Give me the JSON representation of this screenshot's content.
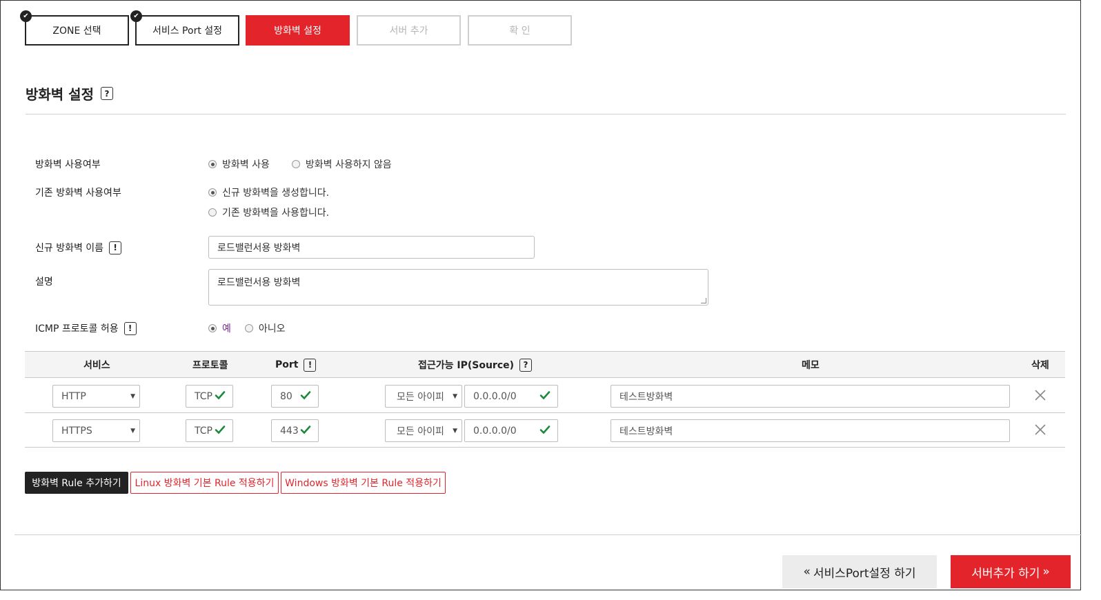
{
  "steps": [
    {
      "label": "ZONE 선택",
      "state": "done"
    },
    {
      "label": "서비스 Port 설정",
      "state": "done"
    },
    {
      "label": "방화벽 설정",
      "state": "active"
    },
    {
      "label": "서버 추가",
      "state": "todo"
    },
    {
      "label": "확 인",
      "state": "todo"
    }
  ],
  "section": {
    "title": "방화벽 설정",
    "help": "?"
  },
  "form": {
    "use_firewall": {
      "label": "방화벽 사용여부",
      "options": [
        "방화벽 사용",
        "방화벽 사용하지 않음"
      ],
      "selected": 0
    },
    "existing_firewall": {
      "label": "기존 방화벽 사용여부",
      "options": [
        "신규 방화벽을 생성합니다.",
        "기존 방화벽을 사용합니다."
      ],
      "selected": 0
    },
    "new_name": {
      "label": "신규 방화벽 이름",
      "value": "로드밸런서용 방화벽"
    },
    "description": {
      "label": "설명",
      "value": "로드밸런서용 방화벽"
    },
    "icmp": {
      "label": "ICMP 프로토콜 허용",
      "options": [
        "예",
        "아니오"
      ],
      "selected": 0
    }
  },
  "table": {
    "headers": {
      "service": "서비스",
      "protocol": "프로토콜",
      "port": "Port",
      "source": "접근가능 IP(Source)",
      "memo": "메모",
      "delete": "삭제"
    },
    "rows": [
      {
        "service": "HTTP",
        "protocol": "TCP",
        "port": "80",
        "source_type": "모든 아이피",
        "source_ip": "0.0.0.0/0",
        "memo": "테스트방화벽"
      },
      {
        "service": "HTTPS",
        "protocol": "TCP",
        "port": "443",
        "source_type": "모든 아이피",
        "source_ip": "0.0.0.0/0",
        "memo": "테스트방화벽"
      }
    ]
  },
  "actions": {
    "add_rule": "방화벽 Rule 추가하기",
    "linux_rule": "Linux 방화벽 기본 Rule 적용하기",
    "windows_rule": "Windows 방화벽 기본 Rule 적용하기"
  },
  "nav": {
    "prev": "서비스Port설정 하기",
    "next": "서버추가 하기"
  },
  "colors": {
    "accent": "#e3242b",
    "dark": "#222222",
    "check": "#1a8a3a"
  }
}
